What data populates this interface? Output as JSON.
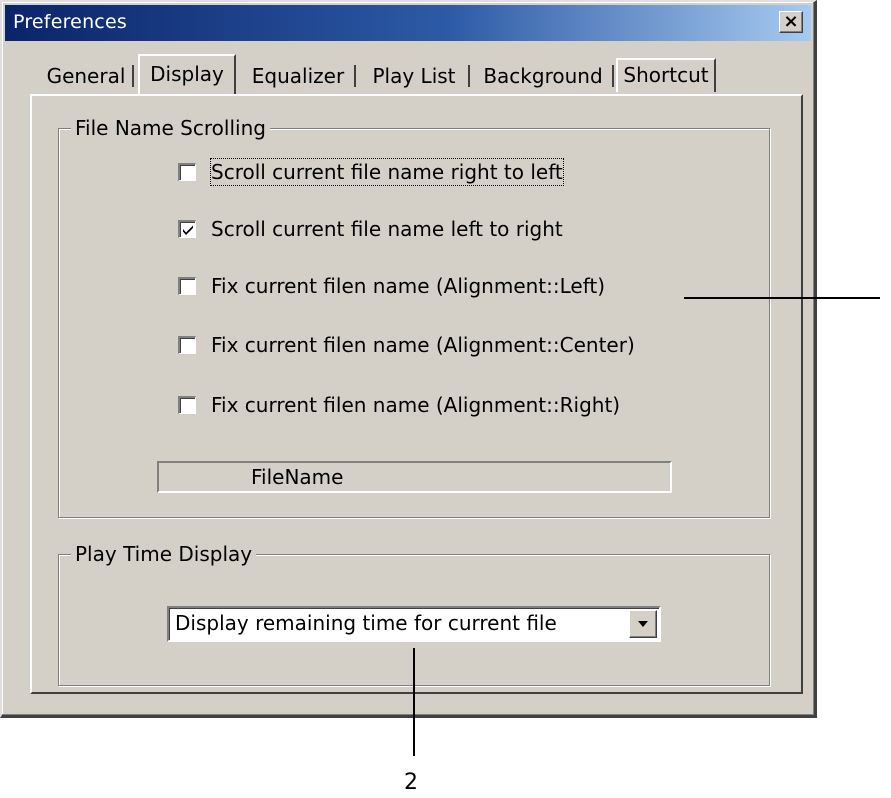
{
  "window": {
    "title": "Preferences",
    "close_label": "×"
  },
  "tabs": [
    {
      "label": "General",
      "active": false
    },
    {
      "label": "Display",
      "active": true
    },
    {
      "label": "Equalizer",
      "active": false
    },
    {
      "label": "Play List",
      "active": false
    },
    {
      "label": "Background",
      "active": false
    },
    {
      "label": "Shortcut",
      "active": false
    }
  ],
  "file_name_scrolling": {
    "title": "File Name Scrolling",
    "options": [
      {
        "label": "Scroll current file name right to left",
        "checked": false
      },
      {
        "label": "Scroll current file name left to right",
        "checked": true
      },
      {
        "label": "Fix current filen name (Alignment::Left)",
        "checked": false
      },
      {
        "label": "Fix current filen name (Alignment::Center)",
        "checked": false
      },
      {
        "label": "Fix current filen name (Alignment::Right)",
        "checked": false
      }
    ],
    "preview_text": "FileName"
  },
  "play_time_display": {
    "title": "Play Time Display",
    "selected": "Display remaining time for current file"
  },
  "callouts": {
    "bottom": "2"
  }
}
